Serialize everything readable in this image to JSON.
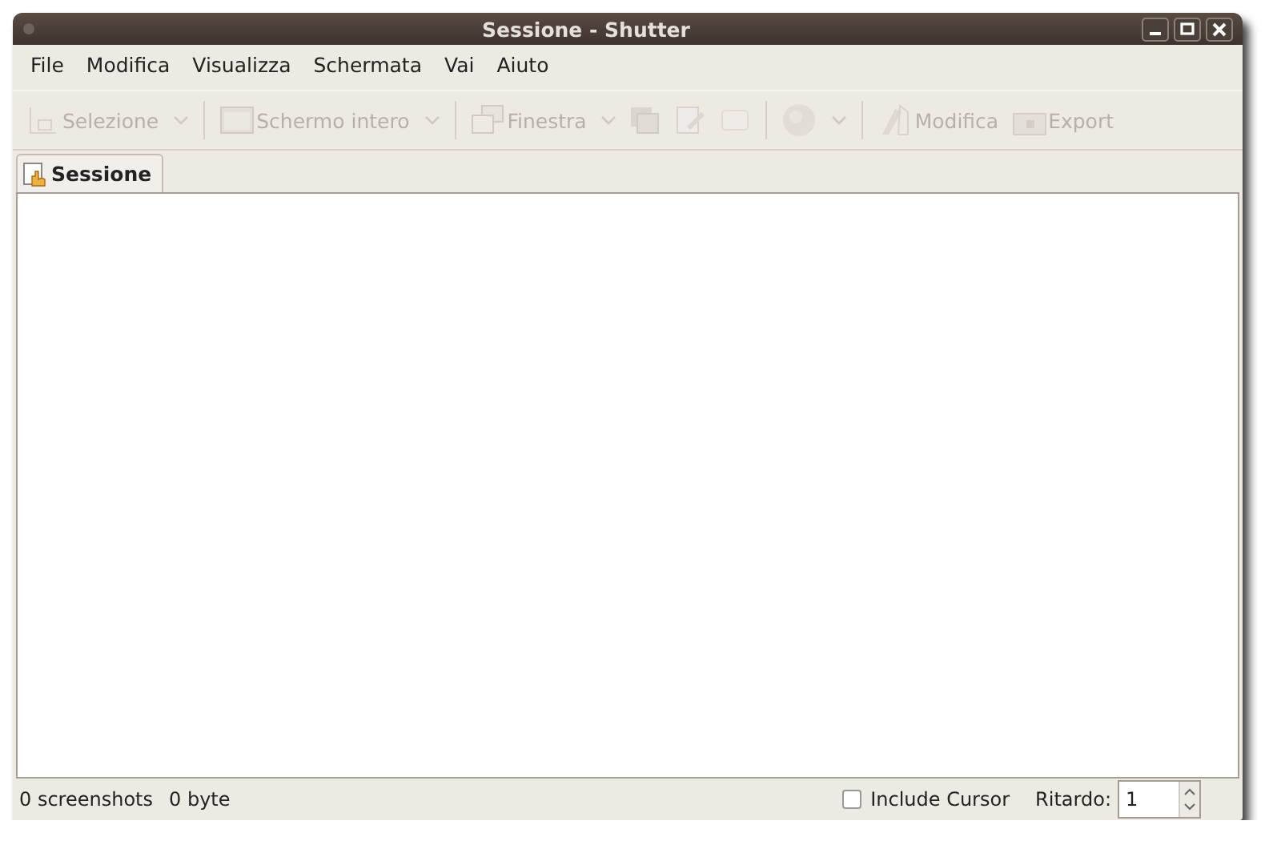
{
  "window": {
    "title": "Sessione - Shutter"
  },
  "menu": [
    {
      "label": "File"
    },
    {
      "label": "Modifica"
    },
    {
      "label": "Visualizza"
    },
    {
      "label": "Schermata"
    },
    {
      "label": "Vai"
    },
    {
      "label": "Aiuto"
    }
  ],
  "toolbar": [
    {
      "kind": "labeled",
      "label": "Selezione",
      "dropdown": true,
      "disabled": true
    },
    {
      "kind": "separator"
    },
    {
      "kind": "labeled",
      "label": "Schermo intero",
      "dropdown": true,
      "disabled": true
    },
    {
      "kind": "separator"
    },
    {
      "kind": "labeled",
      "label": "Finestra",
      "dropdown": true,
      "disabled": true
    },
    {
      "kind": "icon",
      "dropdown": false,
      "disabled": true
    },
    {
      "kind": "icon",
      "dropdown": false,
      "disabled": true
    },
    {
      "kind": "icon",
      "dropdown": false,
      "disabled": true
    },
    {
      "kind": "separator"
    },
    {
      "kind": "icon",
      "dropdown": true,
      "disabled": true
    },
    {
      "kind": "separator"
    },
    {
      "kind": "labeled",
      "label": "Modifica",
      "dropdown": false,
      "disabled": true
    },
    {
      "kind": "labeled",
      "label": "Export",
      "dropdown": false,
      "disabled": true
    }
  ],
  "tabs": [
    {
      "label": "Sessione",
      "selected": true
    }
  ],
  "status_bar": {
    "count": "0 screenshots",
    "size": "0 byte",
    "include_cursor": {
      "label": "Include Cursor",
      "checked": false
    },
    "delay": {
      "label": "Ritardo:",
      "value": "1"
    }
  }
}
